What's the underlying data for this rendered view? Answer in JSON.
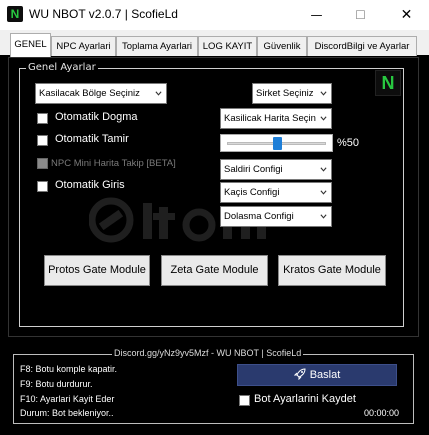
{
  "window": {
    "icon_letter": "N",
    "title": "WU NBOT v2.0.7 | ScofieLd",
    "minimize": "—",
    "maximize": "☐",
    "close": "✕"
  },
  "tabs": [
    {
      "label": "GENEL",
      "active": true
    },
    {
      "label": "NPC Ayarlari",
      "active": false
    },
    {
      "label": "Toplama Ayarlari",
      "active": false
    },
    {
      "label": "LOG KAYIT",
      "active": false
    },
    {
      "label": "Güvenlik",
      "active": false
    },
    {
      "label": "DiscordBilgi ve Ayarlar",
      "active": false
    }
  ],
  "general": {
    "group_title": "Genel Ayarlar",
    "logo_letter": "N",
    "region_select": "Kasilacak Bölge Seçiniz",
    "company_select": "Sirket Seçiniz",
    "map_select": "Kasilicak Harita Seçin",
    "checkboxes": {
      "auto_dodge": {
        "label": "Otomatik Dogma",
        "checked": false
      },
      "auto_repair": {
        "label": "Otomatik Tamir",
        "checked": false
      },
      "npc_minimap": {
        "label": "NPC Mini Harita Takip [BETA]",
        "checked": false,
        "disabled": true
      },
      "auto_login": {
        "label": "Otomatik Giris",
        "checked": false
      }
    },
    "slider_value": 0.5,
    "slider_label": "%50",
    "attack_config": "Saldiri Configi",
    "flee_config": "Kaçis Configi",
    "roam_config": "Dolasma Configi",
    "gate_buttons": {
      "protos": "Protos Gate Module",
      "zeta": "Zeta Gate Module",
      "kratos": "Kratos Gate Module"
    }
  },
  "footer": {
    "legend": "Discord.gg/yNz9yv5Mzf - WU NBOT | ScofieLd",
    "lines": [
      "F8: Botu komple kapatir.",
      "F9: Botu durdurur.",
      "F10: Ayarlari Kayit Eder"
    ],
    "status": "Durum: Bot bekleniyor..",
    "start_button": "Baslat",
    "save_settings": {
      "label": "Bot Ayarlarini Kaydet",
      "checked": false
    },
    "timer": "00:00:00"
  },
  "colors": {
    "background": "#000000",
    "accent_green": "#28c840",
    "start_button": "#2a3a6e",
    "slider_thumb": "#1e7fd8"
  }
}
